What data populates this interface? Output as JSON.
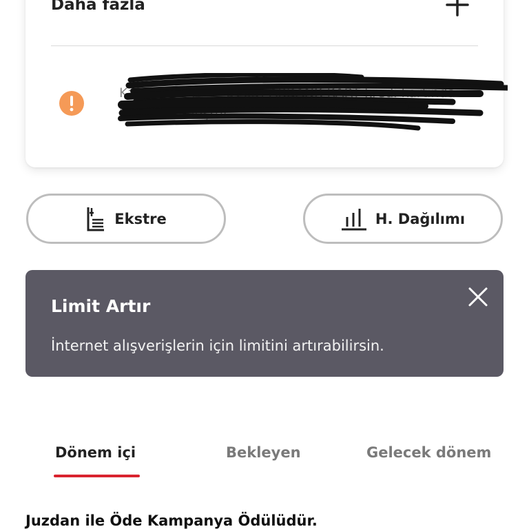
{
  "card": {
    "more_label": "Daha fazla",
    "notice_text": "Kart şifren (**** 5765) AKBANK KART kredi kartında bloke konmuştur."
  },
  "actions": {
    "ekstre_label": "Ekstre",
    "dagilim_label": "H. Dağılımı"
  },
  "banner": {
    "title": "Limit Artır",
    "text": "İnternet alışverişlerin için limitini artırabilirsin."
  },
  "tabs": [
    {
      "label": "Dönem içi",
      "active": true
    },
    {
      "label": "Bekleyen",
      "active": false
    },
    {
      "label": "Gelecek dönem",
      "active": false
    }
  ],
  "section": {
    "heading": "Juzdan ile Öde Kampanya Ödülüdür."
  },
  "colors": {
    "accent": "#d9232e",
    "warning": "#f59a57",
    "banner_bg": "#5b5964"
  },
  "icons": [
    "plus-icon",
    "warning-icon",
    "statement-icon",
    "bar-chart-icon",
    "close-icon"
  ]
}
